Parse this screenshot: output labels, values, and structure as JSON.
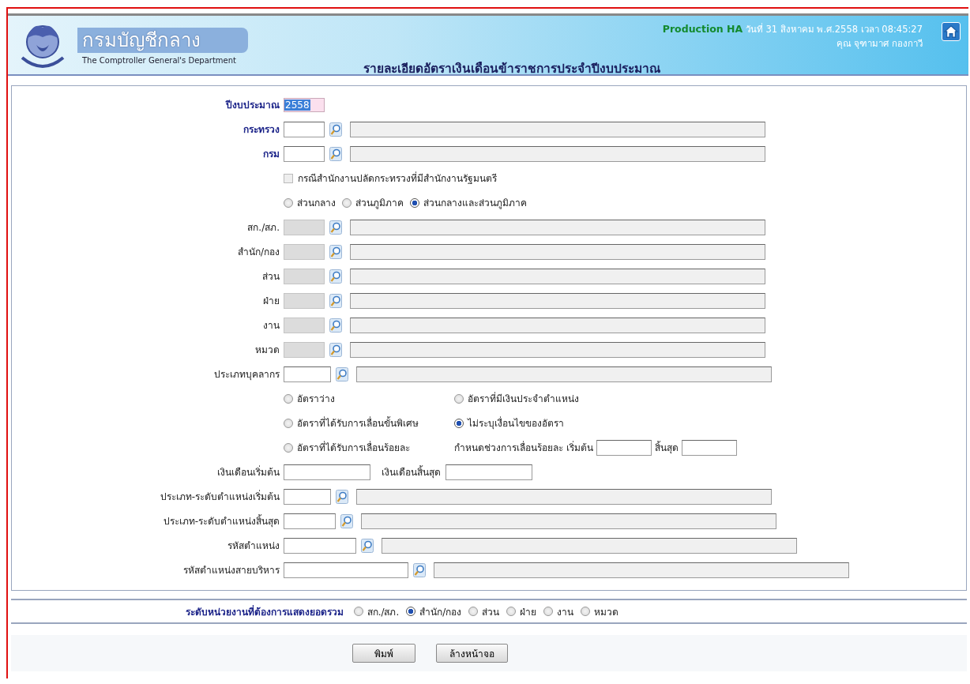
{
  "header": {
    "logo_thai": "กรมบัญชีกลาง",
    "logo_english": "The Comptroller General's Department",
    "environment": "Production HA",
    "datetime": "วันที่ 31 สิงหาคม พ.ศ.2558 เวลา 08:45:27",
    "user": "คุณ จุฑามาศ กองกาวี",
    "page_title": "รายละเอียดอัตราเงินเดือนข้าราชการประจำปีงบประมาณ"
  },
  "form": {
    "year": {
      "label": "ปีงบประมาณ",
      "value": "2558"
    },
    "rows": [
      {
        "kind": "lookup",
        "label": "กระทรวง",
        "required": true,
        "disabled": false
      },
      {
        "kind": "lookup",
        "label": "กรม",
        "required": true,
        "disabled": false
      },
      {
        "kind": "checkbox",
        "label": "กรณีสำนักงานปลัดกระทรวงที่มีสำนักงานรัฐมนตรี",
        "checked": false,
        "disabled": true
      },
      {
        "kind": "radios",
        "options": [
          {
            "label": "ส่วนกลาง",
            "selected": false
          },
          {
            "label": "ส่วนภูมิภาค",
            "selected": false
          },
          {
            "label": "ส่วนกลางและส่วนภูมิภาค",
            "selected": true
          }
        ]
      },
      {
        "kind": "lookup",
        "label": "สก./สภ.",
        "required": false,
        "disabled": true
      },
      {
        "kind": "lookup",
        "label": "สำนัก/กอง",
        "required": false,
        "disabled": true
      },
      {
        "kind": "lookup",
        "label": "ส่วน",
        "required": false,
        "disabled": true
      },
      {
        "kind": "lookup",
        "label": "ฝ่าย",
        "required": false,
        "disabled": true
      },
      {
        "kind": "lookup",
        "label": "งาน",
        "required": false,
        "disabled": true
      },
      {
        "kind": "lookup",
        "label": "หมวด",
        "required": false,
        "disabled": true
      },
      {
        "kind": "lookup",
        "label": "ประเภทบุคลากร",
        "required": false,
        "disabled": false
      },
      {
        "kind": "rate_options",
        "options": [
          {
            "label": "อัตราว่าง",
            "selected": false
          },
          {
            "label": "อัตราที่มีเงินประจำตำแหน่ง",
            "selected": false
          },
          {
            "label": "อัตราที่ได้รับการเลื่อนขั้นพิเศษ",
            "selected": false
          },
          {
            "label": "ไม่ระบุเงื่อนไขของอัตรา",
            "selected": true
          },
          {
            "label": "อัตราที่ได้รับการเลื่อนร้อยละ",
            "selected": false
          }
        ],
        "range_label": "กำหนดช่วงการเลื่อนร้อยละ เริ่มต้น",
        "range_end_label": "สิ้นสุด"
      },
      {
        "kind": "salary_range",
        "label": "เงินเดือนเริ่มต้น",
        "end_label": "เงินเดือนสิ้นสุด"
      },
      {
        "kind": "lookup",
        "label": "ประเภท-ระดับตำแหน่งเริ่มต้น",
        "required": false,
        "disabled": false
      },
      {
        "kind": "lookup",
        "label": "ประเภท-ระดับตำแหน่งสิ้นสุด",
        "required": false,
        "disabled": false
      },
      {
        "kind": "lookup",
        "label": "รหัสตำแหน่ง",
        "required": false,
        "disabled": false
      },
      {
        "kind": "lookup",
        "label": "รหัสตำแหน่งสายบริหาร",
        "required": false,
        "disabled": false
      }
    ]
  },
  "summary": {
    "label": "ระดับหน่วยงานที่ต้องการแสดงยอดรวม",
    "options": [
      {
        "label": "สก./สภ.",
        "selected": false
      },
      {
        "label": "สำนัก/กอง",
        "selected": true
      },
      {
        "label": "ส่วน",
        "selected": false
      },
      {
        "label": "ฝ่าย",
        "selected": false
      },
      {
        "label": "งาน",
        "selected": false
      },
      {
        "label": "หมวด",
        "selected": false
      }
    ]
  },
  "buttons": [
    "พิมพ์",
    "ล้างหน้าจอ"
  ]
}
